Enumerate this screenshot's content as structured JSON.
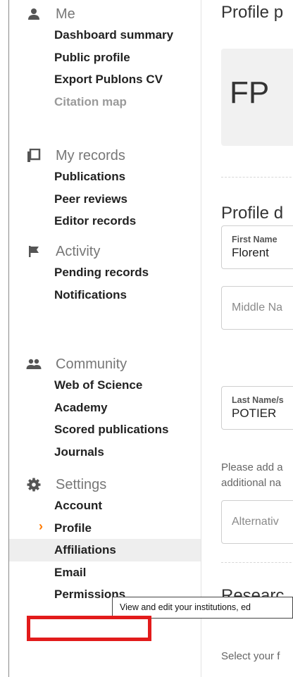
{
  "sidebar": {
    "me": {
      "label": "Me",
      "items": [
        "Dashboard summary",
        "Public profile",
        "Export Publons CV",
        "Citation map"
      ]
    },
    "records": {
      "label": "My records",
      "items": [
        "Publications",
        "Peer reviews",
        "Editor records"
      ]
    },
    "activity": {
      "label": "Activity",
      "items": [
        "Pending records",
        "Notifications"
      ]
    },
    "community": {
      "label": "Community",
      "items": [
        "Web of Science",
        "Academy",
        "Scored publications",
        "Journals"
      ]
    },
    "settings": {
      "label": "Settings",
      "items": [
        "Account",
        "Profile",
        "Affiliations",
        "Email",
        "Permissions"
      ]
    }
  },
  "main": {
    "profile_photo_title": "Profile p",
    "avatar_initials": "FP",
    "profile_details_title": "Profile d",
    "first_name": {
      "label": "First Name",
      "value": "Florent"
    },
    "middle_name": {
      "placeholder": "Middle Na"
    },
    "last_name": {
      "label": "Last Name/s",
      "value": "POTIER"
    },
    "paragraph_line1": "Please add a",
    "paragraph_line2": "additional na",
    "alternative": {
      "placeholder": "Alternativ"
    },
    "research_title": "Researc",
    "select_text": "Select your f"
  },
  "tooltip": "View and edit your institutions, ed",
  "colors": {
    "caret": "#ff7a00",
    "highlight": "#e21b1b",
    "selected_bg": "#eeeeee"
  }
}
